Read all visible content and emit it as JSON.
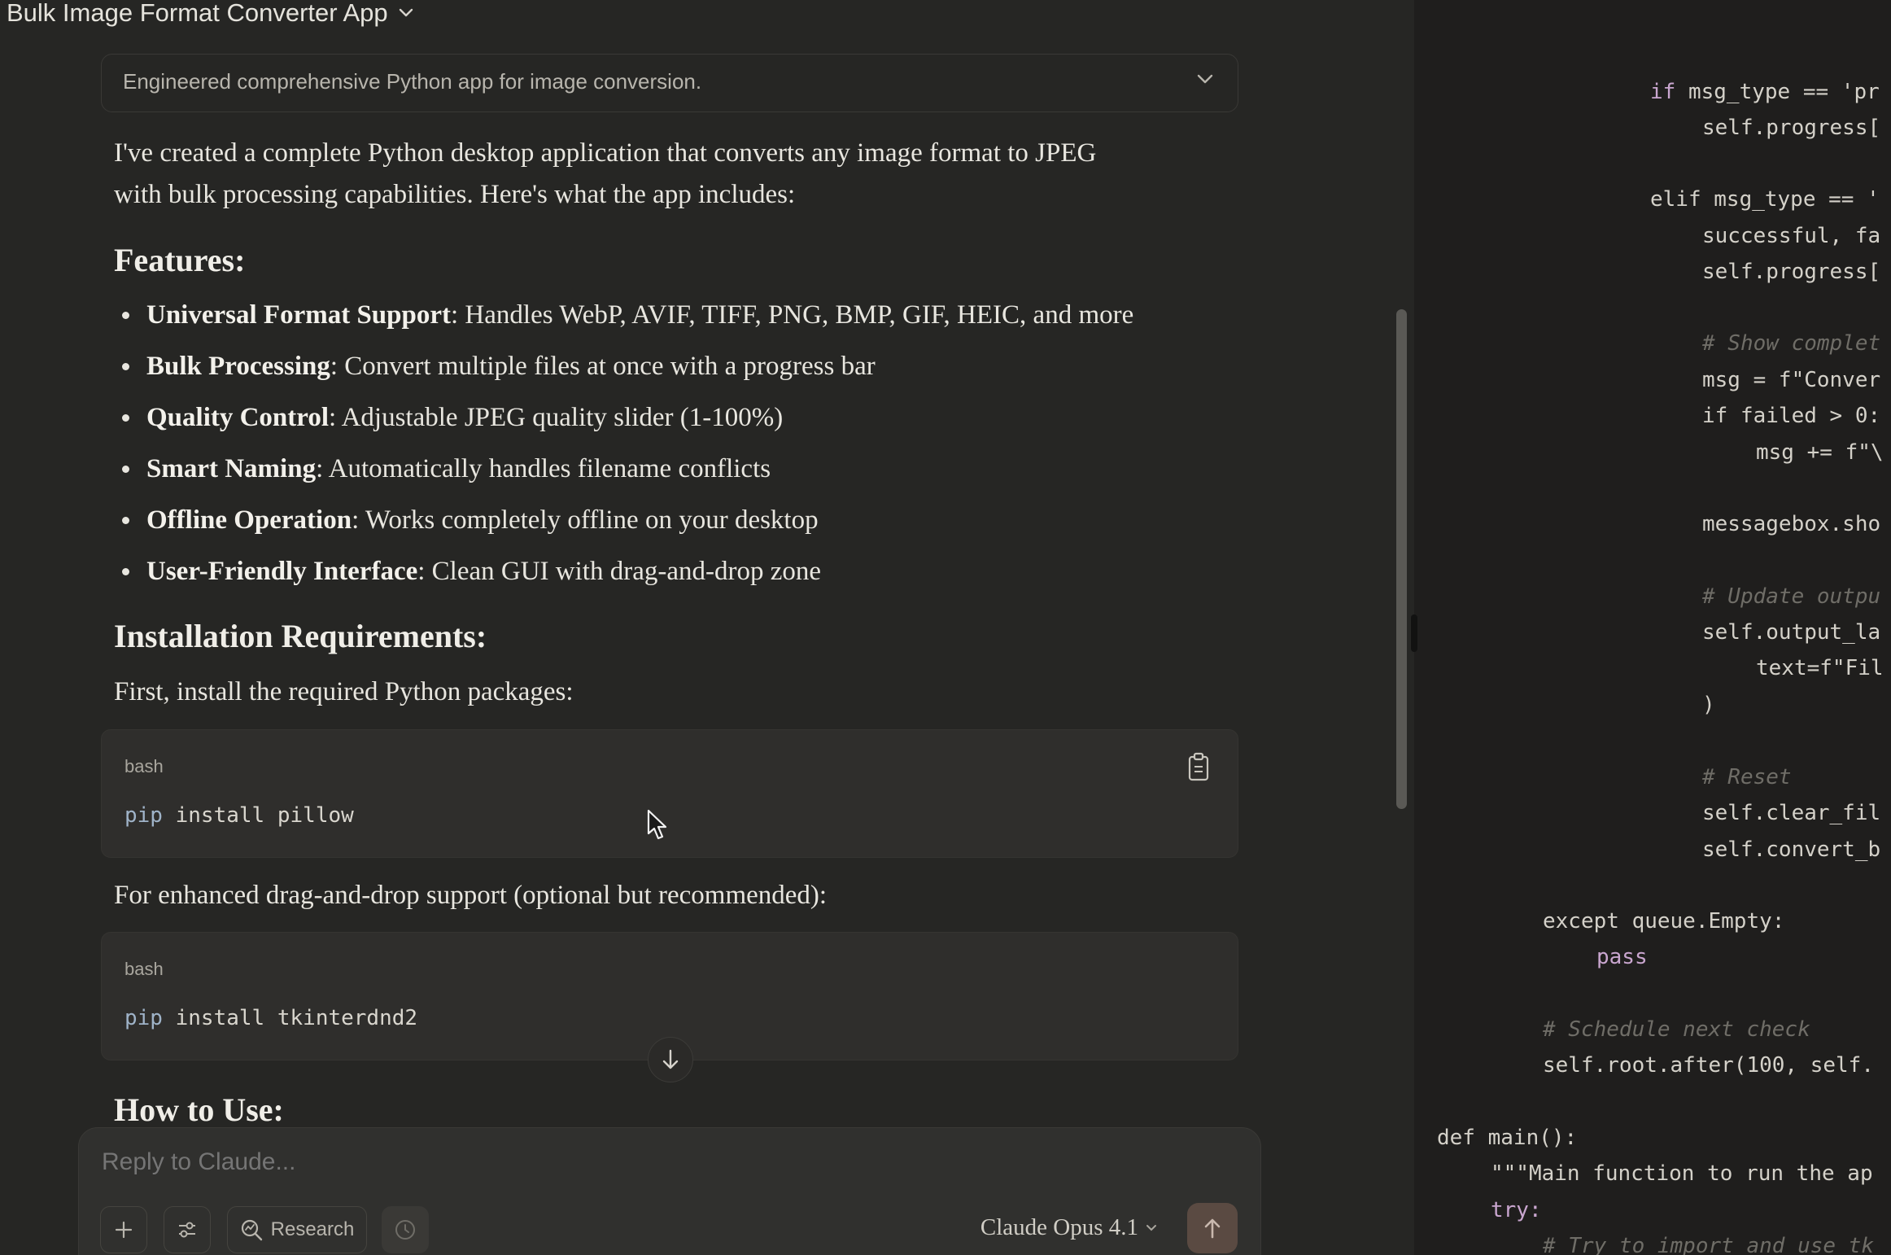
{
  "header": {
    "title": "Bulk Image Format Converter App"
  },
  "thinking": {
    "summary": "Engineered comprehensive Python app for image conversion."
  },
  "message": {
    "intro_line1": "I've created a complete Python desktop application that converts any image format to JPEG",
    "intro_line2": "with bulk processing capabilities. Here's what the app includes:",
    "features_heading": "Features:",
    "features": [
      {
        "title": "Universal Format Support",
        "desc": ": Handles WebP, AVIF, TIFF, PNG, BMP, GIF, HEIC, and more"
      },
      {
        "title": "Bulk Processing",
        "desc": ": Convert multiple files at once with a progress bar"
      },
      {
        "title": "Quality Control",
        "desc": ": Adjustable JPEG quality slider (1-100%)"
      },
      {
        "title": "Smart Naming",
        "desc": ": Automatically handles filename conflicts"
      },
      {
        "title": "Offline Operation",
        "desc": ": Works completely offline on your desktop"
      },
      {
        "title": "User-Friendly Interface",
        "desc": ": Clean GUI with drag-and-drop zone"
      }
    ],
    "install_heading": "Installation Requirements:",
    "install_intro": "First, install the required Python packages:",
    "code1": {
      "lang": "bash",
      "cmd_a": "pip",
      "cmd_b": " install ",
      "cmd_c": "pillow"
    },
    "dnd_intro": "For enhanced drag-and-drop support (optional but recommended):",
    "code2": {
      "lang": "bash",
      "cmd_a": "pip",
      "cmd_b": " install ",
      "cmd_c": "tkinterdnd2"
    },
    "howto_heading": "How to Use:"
  },
  "composer": {
    "placeholder": "Reply to Claude...",
    "research_label": "Research",
    "model_name": "Claude Opus 4.1"
  },
  "code_panel": {
    "lines": [
      "if msg_type == 'pr",
      "self.progress[",
      "elif msg_type == '",
      "successful, fa",
      "self.progress[",
      "# Show complet",
      "msg = f\"Conver",
      "if failed > 0:",
      "msg += f\"\\",
      "messagebox.sho",
      "# Update outpu",
      "self.output_la",
      "text=f\"Fil",
      ")",
      "# Reset",
      "self.clear_fil",
      "self.convert_b",
      "except queue.Empty:",
      "pass",
      "# Schedule next check",
      "self.root.after(100, self.",
      "def main():",
      "\"\"\"Main function to run the ap",
      "try:",
      "# Try to import and use tk"
    ]
  }
}
